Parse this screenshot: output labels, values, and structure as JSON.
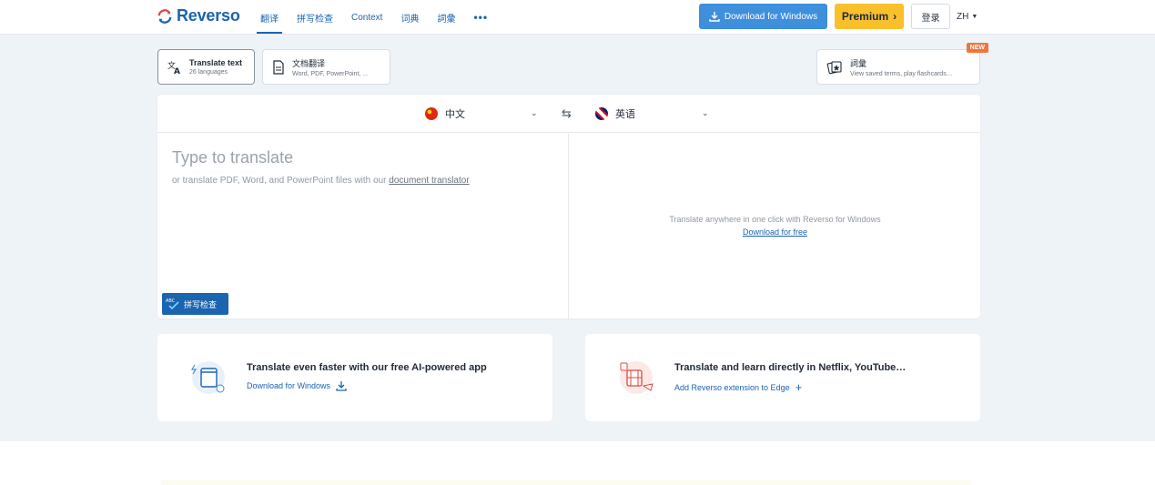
{
  "header": {
    "logo_text": "Reverso",
    "nav": [
      {
        "label": "翻译",
        "active": true
      },
      {
        "label": "拼写检查",
        "active": false
      },
      {
        "label": "Context",
        "active": false
      },
      {
        "label": "词典",
        "active": false
      },
      {
        "label": "詞彙",
        "active": false
      },
      {
        "label": "•••",
        "active": false
      }
    ],
    "download_label": "Download for Windows",
    "premium_label": "Premium",
    "login_label": "登录",
    "lang_label": "ZH"
  },
  "modes": {
    "translate_text": {
      "title": "Translate text",
      "subtitle": "26 languages"
    },
    "doc_translate": {
      "title": "文档翻译",
      "subtitle": "Word, PDF, PowerPoint, ..."
    },
    "vocab": {
      "title": "詞彙",
      "subtitle": "View saved terms, play flashcards…",
      "badge": "NEW"
    }
  },
  "translator": {
    "source_lang": "中文",
    "target_lang": "英语",
    "placeholder_title": "Type to translate",
    "placeholder_sub_prefix": "or translate PDF, Word, and PowerPoint files with our ",
    "placeholder_sub_link": "document translator",
    "spellcheck_label": "拼写检查",
    "spellcheck_abc": "ABC",
    "promo_text": "Translate anywhere in one click with Reverso for Windows",
    "promo_link": "Download for free"
  },
  "cards": [
    {
      "title": "Translate even faster with our free AI-powered app",
      "link": "Download for Windows"
    },
    {
      "title": "Translate and learn directly in Netflix, YouTube…",
      "link": "Add Reverso extension to Edge"
    }
  ],
  "colors": {
    "brand": "#1a64b0",
    "download_btn": "#3e8fdc",
    "premium": "#f9c02c",
    "badge": "#f3743a",
    "bg": "#eef3f7"
  }
}
